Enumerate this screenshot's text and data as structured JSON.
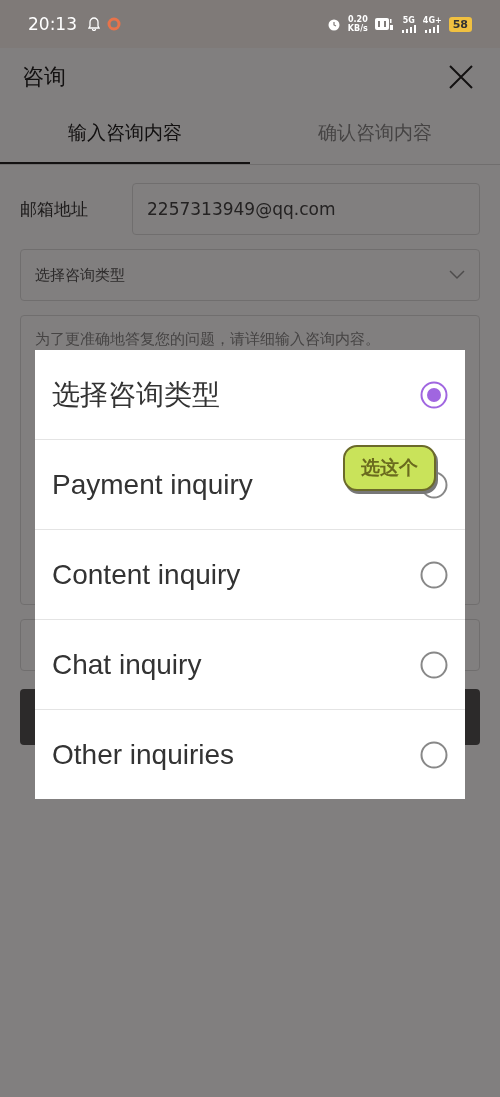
{
  "status_bar": {
    "time": "20:13",
    "speed": "0.20",
    "speed_unit": "KB/s",
    "network_1": "5G",
    "network_2": "4G+",
    "battery": "58"
  },
  "header": {
    "title": "咨询"
  },
  "tabs": [
    {
      "label": "输入咨询内容",
      "selected": true
    },
    {
      "label": "确认咨询内容",
      "selected": false
    }
  ],
  "form": {
    "email_label": "邮箱地址",
    "email_value": "2257313949@qq.com",
    "type_select": "选择咨询类型",
    "content_placeholder": "为了更准确地答复您的问题，请详细输入咨询内容。"
  },
  "dialog": {
    "options": [
      {
        "label": "选择咨询类型",
        "selected": true
      },
      {
        "label": "Payment inquiry",
        "selected": false
      },
      {
        "label": "Content inquiry",
        "selected": false
      },
      {
        "label": "Chat inquiry",
        "selected": false
      },
      {
        "label": "Other inquiries",
        "selected": false
      }
    ]
  },
  "sticker": {
    "text": "选这个"
  }
}
